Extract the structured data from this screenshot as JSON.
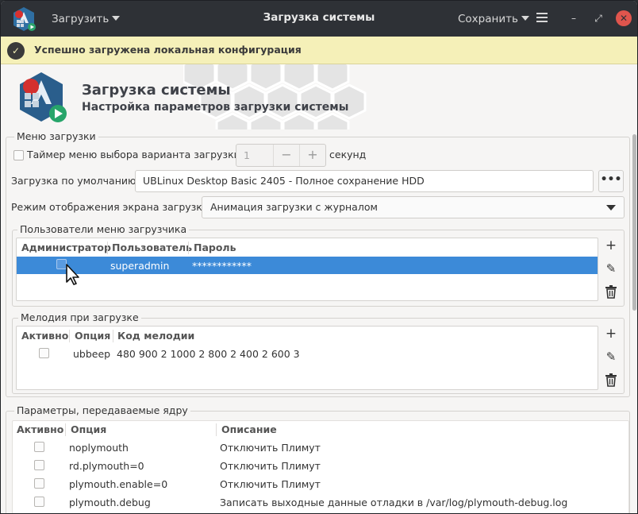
{
  "header": {
    "load_menu": "Загрузить",
    "title": "Загрузка системы",
    "save_menu": "Сохранить"
  },
  "infobar": {
    "message": "Успешно загружена локальная конфигурация"
  },
  "banner": {
    "title": "Загрузка системы",
    "subtitle": "Настройка параметров загрузки системы"
  },
  "boot_menu": {
    "legend": "Меню загрузки",
    "timer_label": "Таймер меню выбора варианта загрузки:",
    "timer_value": "1",
    "timer_unit": "секунд",
    "default_label": "Загрузка по умолчанию:",
    "default_value": "UBLinux Desktop Basic 2405 - Полное сохранение HDD",
    "dots": "•••",
    "display_label": "Режим отображения экрана загрузки:",
    "display_value": "Анимация загрузки с журналом"
  },
  "users": {
    "legend": "Пользователи меню загрузчика",
    "columns": [
      "Администратор",
      "Пользователь",
      "Пароль"
    ],
    "rows": [
      {
        "user": "superadmin",
        "password": "************"
      }
    ]
  },
  "melody": {
    "legend": "Мелодия при загрузке",
    "columns": [
      "Активно",
      "Опция",
      "Код мелодии"
    ],
    "rows": [
      {
        "option": "ubbeep",
        "code": "480 900 2 1000 2 800 2 400 2 600 3"
      }
    ]
  },
  "kernel": {
    "legend": "Параметры, передаваемые ядру",
    "columns": [
      "Активно",
      "Опция",
      "Описание"
    ],
    "rows": [
      {
        "option": "noplymouth",
        "desc": "Отключить Плимут"
      },
      {
        "option": "rd.plymouth=0",
        "desc": "Отключить Плимут"
      },
      {
        "option": "plymouth.enable=0",
        "desc": "Отключить Плимут"
      },
      {
        "option": "plymouth.debug",
        "desc": "Записать выходные данные отладки в /var/log/plymouth-debug.log"
      }
    ]
  },
  "icons": {
    "app": "ublinux-boot-icon",
    "info": "checkmark-circle-icon",
    "add": "plus-icon",
    "edit": "pencil-icon",
    "delete": "trash-icon",
    "menu": "hamburger-icon"
  }
}
